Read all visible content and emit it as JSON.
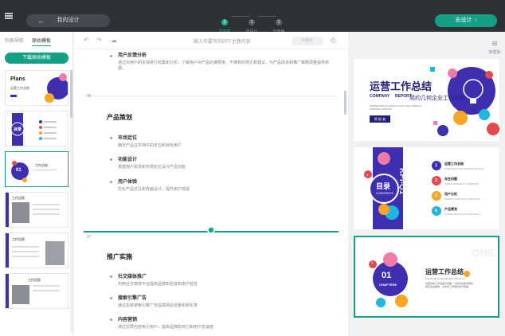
{
  "topbar": {
    "back_label": "我的设计",
    "steps": [
      {
        "num": "1",
        "label": "写内容"
      },
      {
        "num": "2",
        "label": "选设计"
      },
      {
        "num": "3",
        "label": "去使用"
      }
    ],
    "generate_label": "去设计"
  },
  "left": {
    "tabs": [
      "列表导航",
      "原始模板"
    ],
    "download_label": "下载原始模板",
    "thumbs": [
      {
        "title": "Plans",
        "subtitle": "运营工作总结"
      },
      {
        "title": "目录"
      },
      {
        "title": "01",
        "subtitle": "工作总结"
      },
      {
        "title": "工作回顾"
      },
      {
        "title": "工作回顾"
      },
      {
        "title": "工作回顾"
      }
    ]
  },
  "editor": {
    "placeholder": "输入你要写的PPT主题内容",
    "beautify": "AI美化",
    "top_item_title": "用户反馈分析",
    "top_item_desc": "通过对用户的反馈进行收集和分析，了解用户对产品的满意度、不满意的地方和建议，为产品改进和推广策略调整提供依据。",
    "pages": [
      {
        "num": "06",
        "title": "产品策划",
        "items": [
          {
            "t": "市场定位",
            "d": "确定产品在市场中的定位和目标用户"
          },
          {
            "t": "功能设计",
            "d": "根据用户需求和市场定位设计产品功能"
          },
          {
            "t": "用户体验",
            "d": "优化产品交互和界面设计，提升用户体验"
          }
        ]
      },
      {
        "num": "07",
        "title": "推广实施",
        "items": [
          {
            "t": "社交媒体推广",
            "d": "利用社交媒体平台提高品牌知名度和用户粘性"
          },
          {
            "t": "搜索引擎广告",
            "d": "通过投放搜索引擎广告提高网站流量和转化率"
          },
          {
            "t": "内容营销",
            "d": "通过优质内容吸引用户，提高品牌影响力和用户忠诚度"
          }
        ]
      }
    ]
  },
  "right": {
    "switch_label": "换模板",
    "slide1": {
      "title": "运营工作总结",
      "en1": "COMPANY",
      "en2": "REPORT",
      "subtitle": "简约几何企业工作计划",
      "desc": "PRESENTING IN DESIGN FOR THE COMPANY SUMMARY REPORT",
      "badge": "简 报 者"
    },
    "slide2": {
      "title": "目录",
      "en": "CONTENTS",
      "kpi": "KPI-Q1",
      "items": [
        {
          "num": "1",
          "t": "运营工作总结",
          "s": "WHAT WE HAVE DONE IN DETAILS"
        },
        {
          "num": "2",
          "t": "存在问题",
          "s": "WHAT WE NEED TO IMPROVE"
        },
        {
          "num": "3",
          "t": "用户分析",
          "s": "INSIGHT ANALYSIS & METHOD"
        },
        {
          "num": "4",
          "t": "产品策划",
          "s": "STORE WITH PLAN & PROJECT"
        }
      ]
    },
    "slide3": {
      "num": "01",
      "en": "CHAPTERS",
      "title": "运营工作总结",
      "sub": "WHAT WE HAVE DONE IN DETAILS",
      "desc": "总结当前工作进度与成果，分析存在的问题并制定改进措施，对未来工作规划进行部署。",
      "bg_text": "ONE",
      "badge": "1"
    }
  },
  "colors": {
    "accent": "#14a085",
    "purple": "#3d2fb0",
    "dark_purple": "#241f78",
    "red": "#e5484d",
    "orange": "#f5a623",
    "cyan": "#1fb6e0",
    "pink": "#f07aa8"
  }
}
